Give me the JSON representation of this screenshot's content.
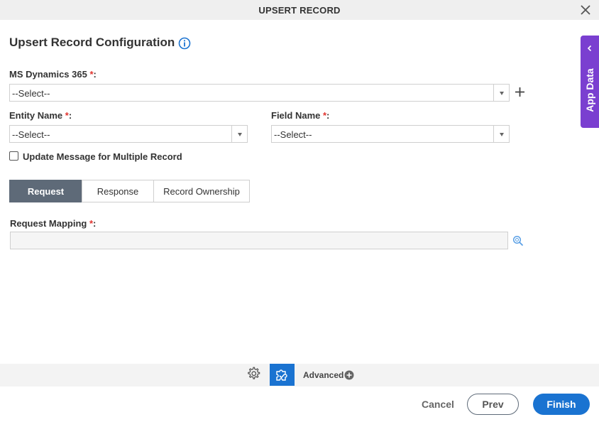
{
  "dialog": {
    "title": "UPSERT RECORD",
    "heading": "Upsert Record Configuration"
  },
  "form": {
    "ms_dynamics": {
      "label": "MS Dynamics 365",
      "required": "*",
      "suffix": ":",
      "value": "--Select--"
    },
    "entity_name": {
      "label": "Entity Name",
      "required": "*",
      "suffix": ":",
      "value": "--Select--"
    },
    "field_name": {
      "label": "Field Name",
      "required": "*",
      "suffix": ":",
      "value": "--Select--"
    },
    "update_message": {
      "label": "Update Message for Multiple Record",
      "checked": false
    },
    "request_mapping": {
      "label": "Request Mapping",
      "required": "*",
      "suffix": ":",
      "value": ""
    }
  },
  "tabs": [
    {
      "label": "Request",
      "active": true
    },
    {
      "label": "Response",
      "active": false
    },
    {
      "label": "Record Ownership",
      "active": false
    }
  ],
  "side_panel": {
    "label": "App Data"
  },
  "footer": {
    "advanced_label": "Advanced",
    "cancel_label": "Cancel",
    "prev_label": "Prev",
    "finish_label": "Finish"
  },
  "icons": {
    "close": "close-icon",
    "info": "info-icon",
    "plus": "plus-icon",
    "lookup": "lookup-icon",
    "chevron": "chevron-left-icon",
    "gear": "gear-icon",
    "puzzle": "puzzle-icon",
    "advanced_plus": "plus-circle-icon"
  },
  "colors": {
    "accent_blue": "#1a73d1",
    "app_data_purple": "#7a3fd0",
    "active_tab": "#5e6a78",
    "required": "#e0342f"
  }
}
